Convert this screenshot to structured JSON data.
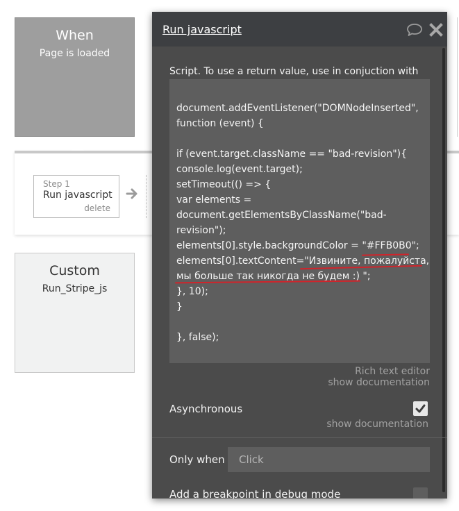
{
  "event_card": {
    "title": "When",
    "subtitle": "Page is loaded"
  },
  "step": {
    "number": "Step 1",
    "name": "Run javascript",
    "delete_label": "delete"
  },
  "custom_card": {
    "title": "Custom",
    "subtitle": "Run_Stripe_js"
  },
  "panel": {
    "title": "Run javascript",
    "script_label": "Script. To use a return value, use in conjuction with",
    "code_lines": [
      "document.addEventListener(\"DOMNodeInserted\",",
      "function (event) {",
      "",
      "if (event.target.className == \"bad-revision\"){",
      " console.log(event.target);",
      "setTimeout(() => {",
      "var elements =",
      "document.getElementsByClassName(\"bad-",
      "revision\");",
      "elements[0].style.backgroundColor = \"#FFB0B0\";",
      "elements[0].textContent=\"Извините, пожалуйста,",
      "мы больше так никогда не будем :) \";",
      "}, 10);",
      "}",
      "",
      "}, false);"
    ],
    "rich_text_editor_link": "Rich text editor",
    "show_documentation_1": "show documentation",
    "asynchronous_label": "Asynchronous",
    "asynchronous_checked": true,
    "show_documentation_2": "show documentation",
    "only_when_label": "Only when",
    "only_when_placeholder": "Click",
    "breakpoint_label": "Add a breakpoint in debug mode"
  },
  "colors": {
    "panel_bg": "#4b4b4b",
    "panel_header_bg": "#3d3f42",
    "code_bg": "#5e5e5e",
    "event_card_bg": "#9e9e9e",
    "annotation_red": "#d0242b"
  },
  "icons": {
    "comment": "comment-bubble-icon",
    "close": "close-x-icon",
    "arrow": "arrow-right-icon",
    "check": "checkmark-icon"
  }
}
